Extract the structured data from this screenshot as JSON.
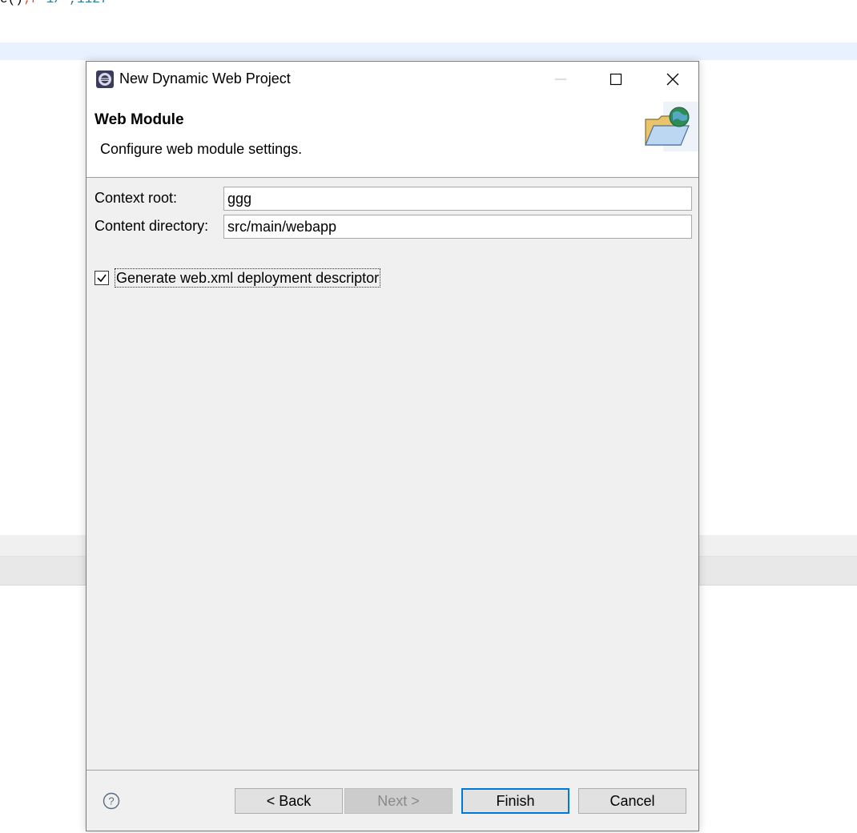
{
  "background": {
    "code_fragment": "e() ;r 1/ ,1127"
  },
  "dialog": {
    "title": "New Dynamic Web Project",
    "window_controls": {
      "minimize": "minimize-icon",
      "maximize": "maximize-icon",
      "close": "close-icon"
    },
    "header": {
      "title": "Web Module",
      "description": "Configure web module settings.",
      "banner_icon": "web-folder-globe-icon"
    },
    "form": {
      "context_root": {
        "label": "Context root:",
        "value": "ggg"
      },
      "content_directory": {
        "label": "Content directory:",
        "value": "src/main/webapp"
      },
      "generate_descriptor": {
        "label": "Generate web.xml deployment descriptor",
        "checked": true
      }
    },
    "footer": {
      "help_icon": "help-icon",
      "back_label": "< Back",
      "next_label": "Next >",
      "finish_label": "Finish",
      "cancel_label": "Cancel"
    }
  },
  "colors": {
    "dialog_bg": "#f0f0f0",
    "focus_accent": "#0078d7",
    "editor_highlight": "#e8f2fe"
  }
}
